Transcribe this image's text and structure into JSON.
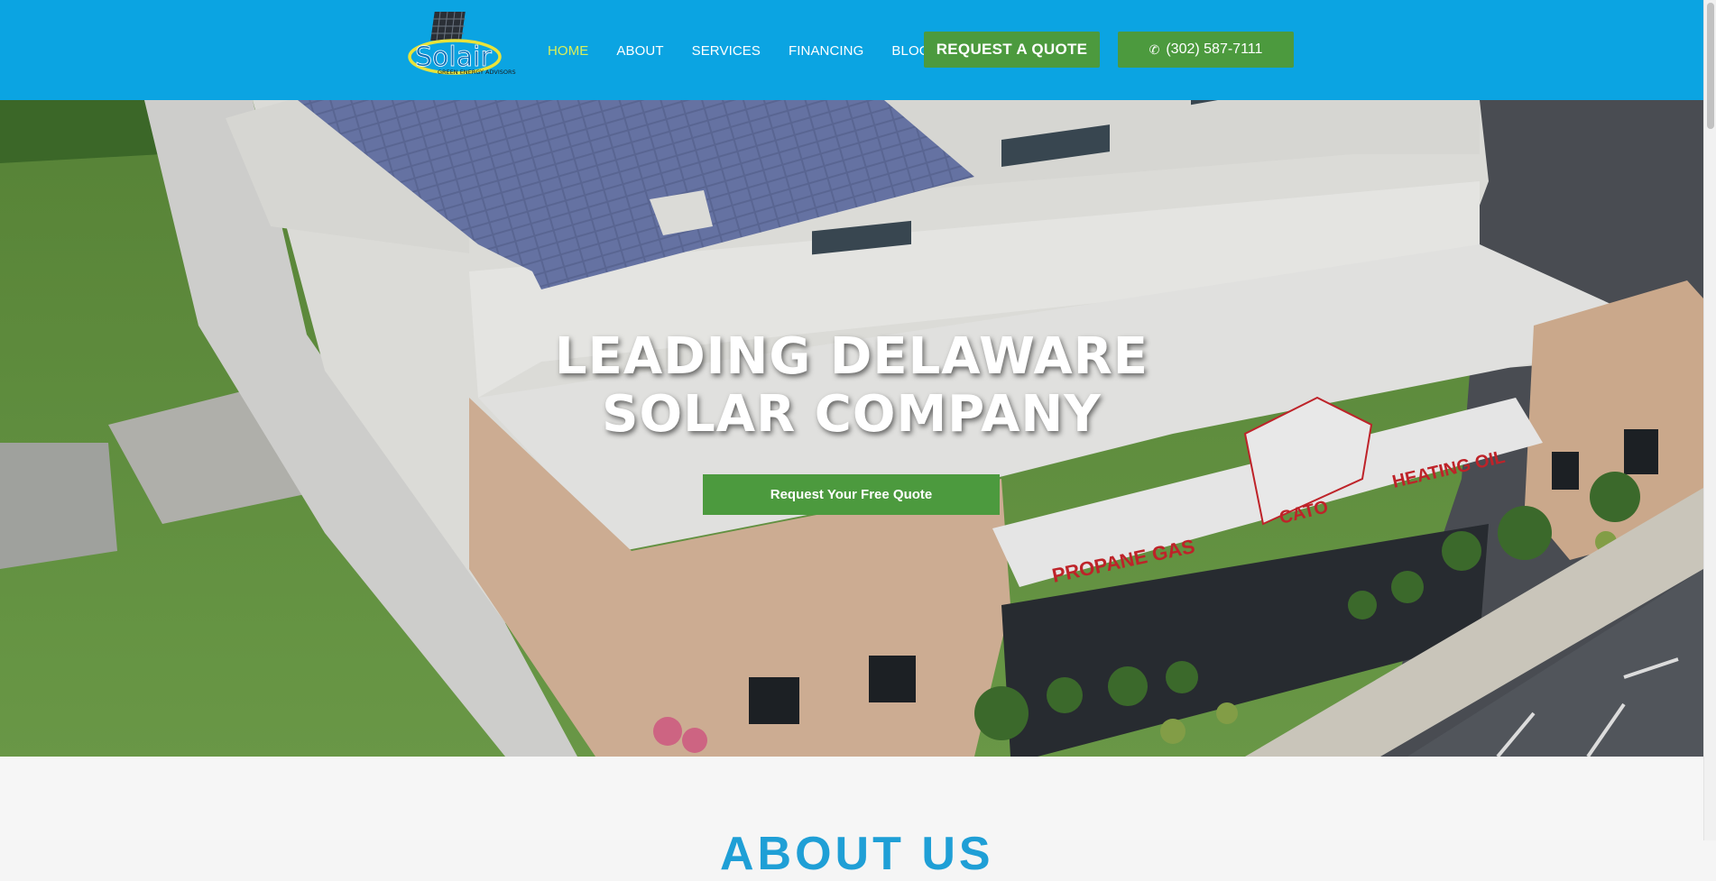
{
  "brand": {
    "logo_text": "Solair",
    "logo_tagline": "GREEN ENERGY ADVISORS",
    "accent": "#0ba4e2",
    "green": "#4c9a3e"
  },
  "nav": {
    "items": [
      {
        "label": "HOME",
        "active": true
      },
      {
        "label": "ABOUT",
        "active": false
      },
      {
        "label": "SERVICES",
        "active": false
      },
      {
        "label": "FINANCING",
        "active": false
      },
      {
        "label": "BLOG",
        "active": false
      }
    ]
  },
  "header": {
    "quote_label": "REQUEST A QUOTE",
    "phone_label": "(302) 587-7111",
    "phone_icon": "phone-icon"
  },
  "hero": {
    "title_line1": "LEADING DELAWARE",
    "title_line2": "SOLAR COMPANY",
    "cta_label": "Request Your Free Quote",
    "image": "aerial-solar-building",
    "signs": {
      "propane": "PROPANE GAS",
      "heating": "HEATING OIL",
      "cato": "CATO"
    }
  },
  "about": {
    "title": "ABOUT US"
  }
}
